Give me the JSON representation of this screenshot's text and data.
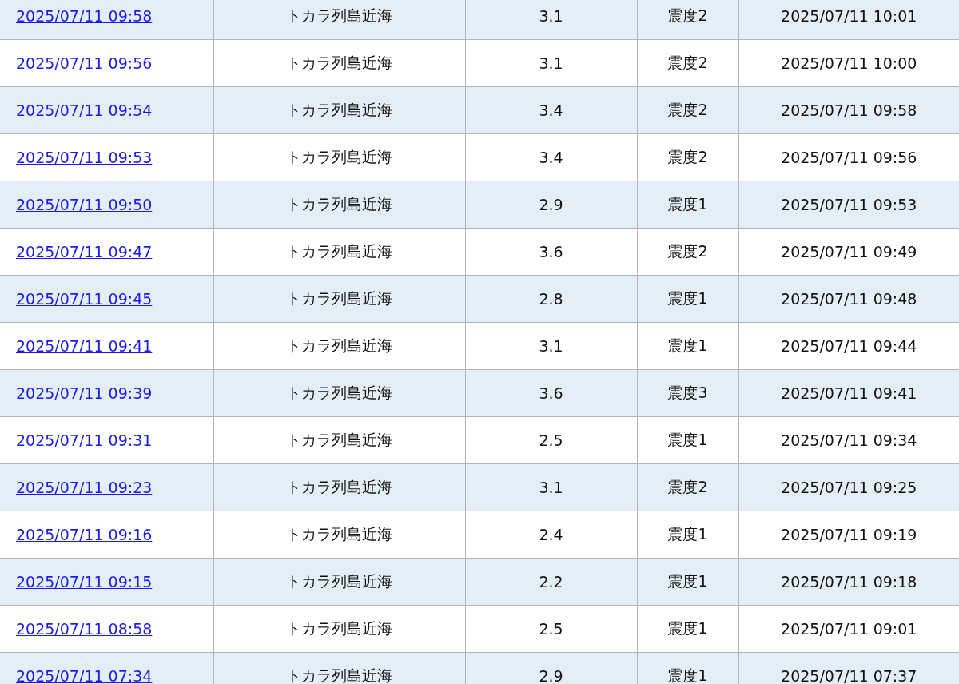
{
  "table": {
    "rows": [
      {
        "origin_time": "2025/07/11 09:58",
        "epicenter": "トカラ列島近海",
        "magnitude": "3.1",
        "max_intensity": "震度2",
        "announced": "2025/07/11 10:01"
      },
      {
        "origin_time": "2025/07/11 09:56",
        "epicenter": "トカラ列島近海",
        "magnitude": "3.1",
        "max_intensity": "震度2",
        "announced": "2025/07/11 10:00"
      },
      {
        "origin_time": "2025/07/11 09:54",
        "epicenter": "トカラ列島近海",
        "magnitude": "3.4",
        "max_intensity": "震度2",
        "announced": "2025/07/11 09:58"
      },
      {
        "origin_time": "2025/07/11 09:53",
        "epicenter": "トカラ列島近海",
        "magnitude": "3.4",
        "max_intensity": "震度2",
        "announced": "2025/07/11 09:56"
      },
      {
        "origin_time": "2025/07/11 09:50",
        "epicenter": "トカラ列島近海",
        "magnitude": "2.9",
        "max_intensity": "震度1",
        "announced": "2025/07/11 09:53"
      },
      {
        "origin_time": "2025/07/11 09:47",
        "epicenter": "トカラ列島近海",
        "magnitude": "3.6",
        "max_intensity": "震度2",
        "announced": "2025/07/11 09:49"
      },
      {
        "origin_time": "2025/07/11 09:45",
        "epicenter": "トカラ列島近海",
        "magnitude": "2.8",
        "max_intensity": "震度1",
        "announced": "2025/07/11 09:48"
      },
      {
        "origin_time": "2025/07/11 09:41",
        "epicenter": "トカラ列島近海",
        "magnitude": "3.1",
        "max_intensity": "震度1",
        "announced": "2025/07/11 09:44"
      },
      {
        "origin_time": "2025/07/11 09:39",
        "epicenter": "トカラ列島近海",
        "magnitude": "3.6",
        "max_intensity": "震度3",
        "announced": "2025/07/11 09:41"
      },
      {
        "origin_time": "2025/07/11 09:31",
        "epicenter": "トカラ列島近海",
        "magnitude": "2.5",
        "max_intensity": "震度1",
        "announced": "2025/07/11 09:34"
      },
      {
        "origin_time": "2025/07/11 09:23",
        "epicenter": "トカラ列島近海",
        "magnitude": "3.1",
        "max_intensity": "震度2",
        "announced": "2025/07/11 09:25"
      },
      {
        "origin_time": "2025/07/11 09:16",
        "epicenter": "トカラ列島近海",
        "magnitude": "2.4",
        "max_intensity": "震度1",
        "announced": "2025/07/11 09:19"
      },
      {
        "origin_time": "2025/07/11 09:15",
        "epicenter": "トカラ列島近海",
        "magnitude": "2.2",
        "max_intensity": "震度1",
        "announced": "2025/07/11 09:18"
      },
      {
        "origin_time": "2025/07/11 08:58",
        "epicenter": "トカラ列島近海",
        "magnitude": "2.5",
        "max_intensity": "震度1",
        "announced": "2025/07/11 09:01"
      },
      {
        "origin_time": "2025/07/11 07:34",
        "epicenter": "トカラ列島近海",
        "magnitude": "2.9",
        "max_intensity": "震度1",
        "announced": "2025/07/11 07:37"
      }
    ]
  }
}
